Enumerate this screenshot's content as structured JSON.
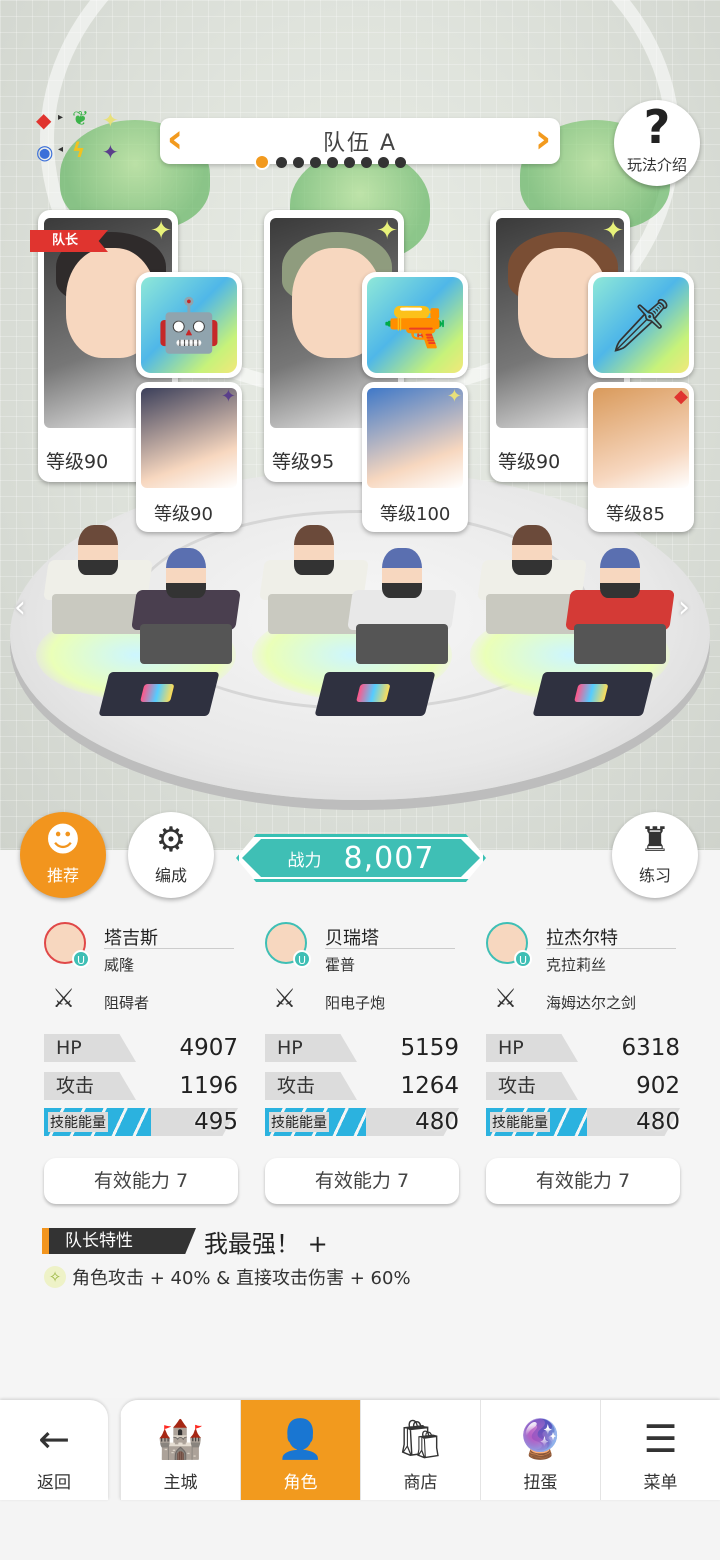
{
  "team": {
    "title": "队伍 A",
    "page_count": 9,
    "active_page": 1,
    "help_label": "玩法介绍"
  },
  "affinity_icons": [
    "diamond-red",
    "leaf-green",
    "star-yellow",
    "circle-blue",
    "bolt-yellow",
    "star-purple"
  ],
  "slots": [
    {
      "leader": true,
      "leader_label": "队长",
      "hero_level": "等级90",
      "equip_icon": "robot-icon",
      "sub_level": "等级90",
      "sub_element": "star-purple",
      "hero_color": "#2f2b2b",
      "sub_color": "#3b3f5a"
    },
    {
      "leader": false,
      "hero_level": "等级95",
      "equip_icon": "cannon-icon",
      "sub_level": "等级100",
      "sub_element": "star-yellow",
      "hero_color": "#8f9c7e",
      "sub_color": "#3f78c8"
    },
    {
      "leader": false,
      "hero_level": "等级90",
      "equip_icon": "sword-icon",
      "sub_level": "等级85",
      "sub_element": "diamond-red",
      "hero_color": "#7a4e34",
      "sub_color": "#d99a5b"
    }
  ],
  "controls": {
    "recommend_label": "推荐",
    "formation_label": "编成",
    "practice_label": "练习",
    "power_label": "战力",
    "power_value": "8,007"
  },
  "heroes": [
    {
      "name": "塔吉斯",
      "sub_name": "威隆",
      "weapon": "阻碍者",
      "hp_label": "HP",
      "hp": "4907",
      "atk_label": "攻击",
      "atk": "1196",
      "energy_label": "技能能量",
      "energy": "495",
      "energy_fill": 0.55,
      "ability": "有效能力 7"
    },
    {
      "name": "贝瑞塔",
      "sub_name": "霍普",
      "weapon": "阳电子炮",
      "hp_label": "HP",
      "hp": "5159",
      "atk_label": "攻击",
      "atk": "1264",
      "energy_label": "技能能量",
      "energy": "480",
      "energy_fill": 0.52,
      "ability": "有效能力 7"
    },
    {
      "name": "拉杰尔特",
      "sub_name": "克拉莉丝",
      "weapon": "海姆达尔之剑",
      "hp_label": "HP",
      "hp": "6318",
      "atk_label": "攻击",
      "atk": "902",
      "energy_label": "技能能量",
      "energy": "480",
      "energy_fill": 0.52,
      "ability": "有效能力 7"
    }
  ],
  "leader_trait": {
    "tag": "队长特性",
    "name": "我最强！ +",
    "desc": "角色攻击 + 40% & 直接攻击伤害 + 60%"
  },
  "nav": {
    "back": "返回",
    "items": [
      "主城",
      "角色",
      "商店",
      "扭蛋",
      "菜单"
    ],
    "active": "角色"
  },
  "colors": {
    "accent": "#f29a1e",
    "power": "#3fbfb5",
    "energy": "#2bb2df",
    "leader": "#e0342f"
  }
}
